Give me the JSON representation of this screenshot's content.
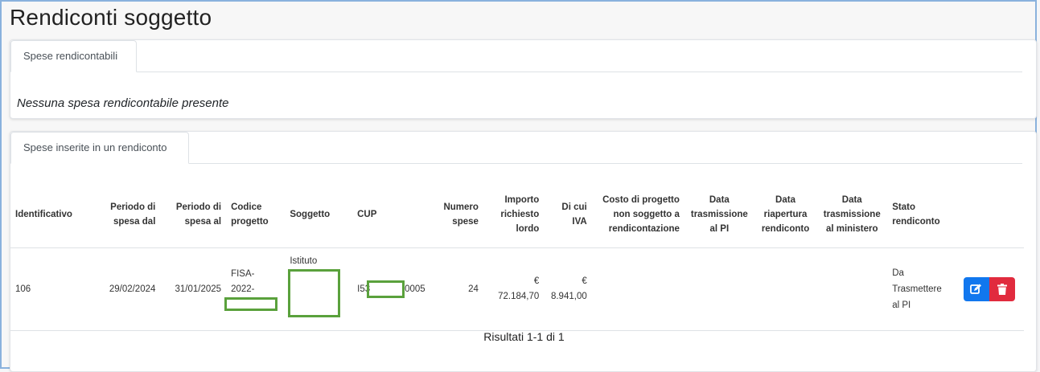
{
  "page": {
    "title": "Rendiconti soggetto"
  },
  "section1": {
    "tab_label": "Spese rendicontabili",
    "empty_message": "Nessuna spesa rendicontabile presente"
  },
  "section2": {
    "tab_label": "Spese inserite in un rendiconto",
    "columns": [
      "Identificativo",
      "Periodo di spesa dal",
      "Periodo di spesa al",
      "Codice progetto",
      "Soggetto",
      "CUP",
      "Numero spese",
      "Importo richiesto lordo",
      "Di cui IVA",
      "Costo di progetto non soggetto a rendicontazione",
      "Data trasmissione al PI",
      "Data riapertura rendiconto",
      "Data trasmissione al ministero",
      "Stato rendiconto"
    ],
    "rows": [
      {
        "identificativo": "106",
        "periodo_dal": "29/02/2024",
        "periodo_al": "31/01/2025",
        "codice_progetto_l1": "FISA-",
        "codice_progetto_l2": "2022-",
        "soggetto": "Istituto",
        "cup_prefix": "I53",
        "cup_suffix": "0005",
        "numero_spese": "24",
        "importo_currency": "€",
        "importo_value": "72.184,70",
        "iva_currency": "€",
        "iva_value": "8.941,00",
        "costo_non_soggetto": "",
        "data_trasmissione_pi": "",
        "data_riapertura": "",
        "data_trasmissione_ministero": "",
        "stato": "Da Trasmettere al PI"
      }
    ],
    "results_text": "Risultati 1-1 di 1"
  },
  "colors": {
    "edit_button": "#1177ee",
    "delete_button": "#e12b3e",
    "redaction_box": "#5aa13c"
  },
  "icons": {
    "edit": "edit-icon",
    "delete": "trash-icon"
  }
}
